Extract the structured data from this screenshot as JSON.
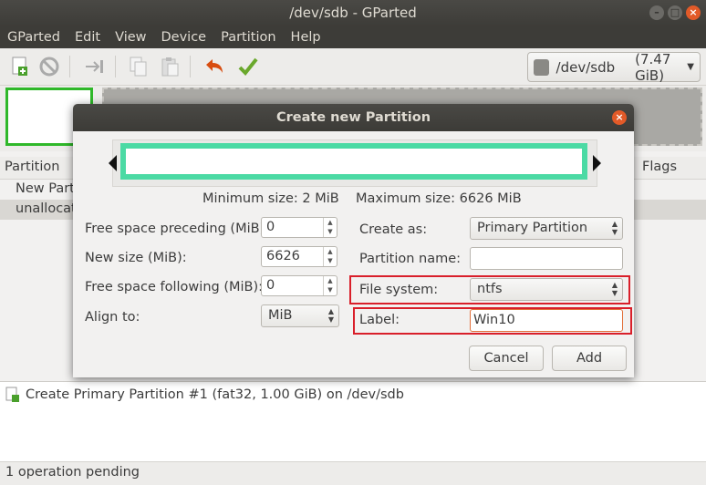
{
  "window": {
    "title": "/dev/sdb - GParted"
  },
  "menu": [
    "GParted",
    "Edit",
    "View",
    "Device",
    "Partition",
    "Help"
  ],
  "toolbar": {
    "icons": [
      "new-partition-icon",
      "delete-icon",
      "resize-move-icon",
      "copy-icon",
      "paste-icon",
      "undo-icon",
      "apply-icon"
    ],
    "device": "/dev/sdb",
    "device_size": "(7.47 GiB)"
  },
  "partition_list": {
    "headers": {
      "partition": "Partition",
      "flags": "Flags"
    },
    "rows": [
      "New Parti",
      "unallocate"
    ]
  },
  "dialog": {
    "title": "Create new Partition",
    "min_size": "Minimum size: 2 MiB",
    "max_size": "Maximum size: 6626 MiB",
    "labels": {
      "free_preceding": "Free space preceding (MiB):",
      "new_size": "New size (MiB):",
      "free_following": "Free space following (MiB):",
      "align_to": "Align to:",
      "create_as": "Create as:",
      "partition_name": "Partition name:",
      "file_system": "File system:",
      "label": "Label:"
    },
    "values": {
      "free_preceding": "0",
      "new_size": "6626",
      "free_following": "0",
      "align_to": "MiB",
      "create_as": "Primary Partition",
      "partition_name": "",
      "file_system": "ntfs",
      "label": "Win10"
    },
    "buttons": {
      "cancel": "Cancel",
      "add": "Add"
    },
    "colors": {
      "highlight": "#d91f2a",
      "partition_bar": "#4bdaa4"
    }
  },
  "pending": {
    "operation": "Create Primary Partition #1 (fat32, 1.00 GiB) on /dev/sdb",
    "status": "1 operation pending"
  }
}
